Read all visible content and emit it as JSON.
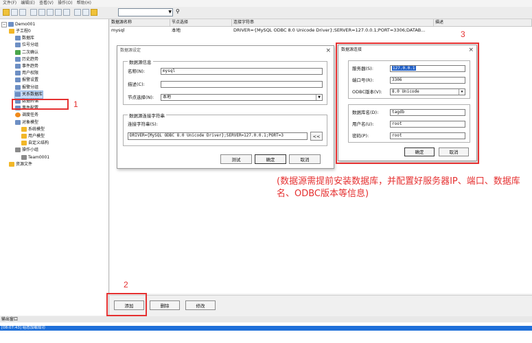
{
  "menu": [
    "文件(F)",
    "编辑(E)",
    "查看(V)",
    "操作(O)",
    "帮助(H)"
  ],
  "toolbar": {
    "combo_value": "",
    "find_icon": "find-icon"
  },
  "tree": {
    "root": "Demo001",
    "nodes": [
      {
        "label": "子工程0",
        "indent": 1,
        "icon": "folder"
      },
      {
        "label": "数据库",
        "indent": 2,
        "icon": "blue"
      },
      {
        "label": "位号分组",
        "indent": 2,
        "icon": "blue"
      },
      {
        "label": "二次确认",
        "indent": 2,
        "icon": "green"
      },
      {
        "label": "历史趋势",
        "indent": 2,
        "icon": "blue"
      },
      {
        "label": "事件趋势",
        "indent": 2,
        "icon": "blue"
      },
      {
        "label": "用户权限",
        "indent": 2,
        "icon": "blue"
      },
      {
        "label": "报警设置",
        "indent": 2,
        "icon": "blue"
      },
      {
        "label": "报警分组",
        "indent": 2,
        "icon": "blue"
      },
      {
        "label": "关系数据库",
        "indent": 2,
        "icon": "blue",
        "selected": true
      },
      {
        "label": "数据转储",
        "indent": 2,
        "icon": "blue"
      },
      {
        "label": "事件配置",
        "indent": 2,
        "icon": "blue"
      },
      {
        "label": "调度任务",
        "indent": 2,
        "icon": "orange"
      },
      {
        "label": "对象模型",
        "indent": 2,
        "icon": "blue"
      },
      {
        "label": "系统模型",
        "indent": 3,
        "icon": "folder"
      },
      {
        "label": "用户模型",
        "indent": 3,
        "icon": "folder"
      },
      {
        "label": "自定义结构",
        "indent": 3,
        "icon": "folder"
      },
      {
        "label": "操作小组",
        "indent": 2,
        "icon": "gray"
      },
      {
        "label": "Team0001",
        "indent": 3,
        "icon": "gray"
      },
      {
        "label": "资源文件",
        "indent": 1,
        "icon": "folder"
      }
    ]
  },
  "grid": {
    "headers": [
      "数据源名称",
      "节点选择",
      "连接字符串",
      "描述"
    ],
    "rows": [
      {
        "name": "mysql",
        "node": "本地",
        "conn": "DRIVER={MySQL ODBC 8.0 Unicode Driver};SERVER=127.0.0.1;PORT=3306;DATAB...",
        "desc": ""
      }
    ]
  },
  "buttons": {
    "add": "添加",
    "delete": "删除",
    "modify": "修改"
  },
  "output": {
    "title": "输出窗口",
    "line": "[08:07:43] 组态加载成功"
  },
  "ds_dialog": {
    "title": "数据源设定",
    "info_group": "数据源信息",
    "name_label": "名称(N):",
    "name_value": "mysql",
    "desc_label": "描述(C):",
    "desc_value": "",
    "node_label": "节点选择(N):",
    "node_value": "本地",
    "conn_group": "数据源连接字符串",
    "conn_label": "连接字符串(S):",
    "conn_value": "DRIVER={MySQL ODBC 8.0 Unicode Driver};SERVER=127.0.0.1;PORT=3",
    "more_button": "<<",
    "test_button": "测试",
    "ok_button": "确定",
    "cancel_button": "取消"
  },
  "conn_dialog": {
    "title": "数据源连接",
    "server_label": "服务器(S):",
    "server_value": "127.0.0.1",
    "port_label": "端口号(R):",
    "port_value": "3306",
    "odbc_label": "ODBC版本(V):",
    "odbc_value": "8.0 Unicode",
    "db_label": "数据库名(D):",
    "db_value": "tagdb",
    "user_label": "用户名(U):",
    "user_value": "root",
    "pwd_label": "密码(P):",
    "pwd_value": "root",
    "ok_button": "确定",
    "cancel_button": "取消"
  },
  "annotations": {
    "num1": "1",
    "num2": "2",
    "num3": "3",
    "note": "(数据源需提前安装数据库，并配置好服务器IP、端口、数据库名、ODBC版本等信息)",
    "color": "#e53030"
  }
}
